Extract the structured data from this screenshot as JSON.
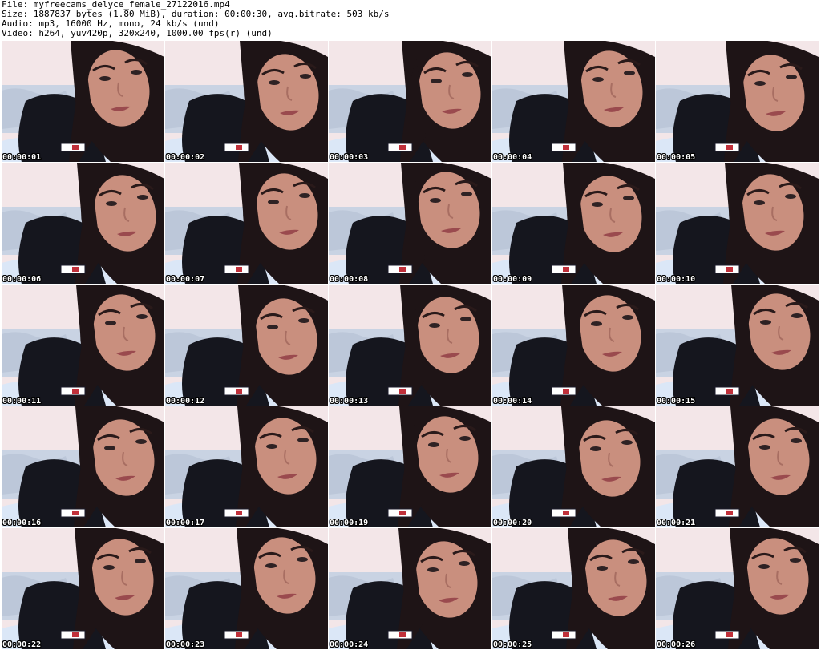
{
  "header": {
    "file_line": "File: myfreecams_delyce_female_27122016.mp4",
    "size_line": "Size: 1887837 bytes (1.80 MiB), duration: 00:00:30, avg.bitrate: 503 kb/s",
    "audio_line": "Audio: mp3, 16000 Hz, mono, 24 kb/s (und)",
    "video_line": "Video: h264, yuv420p, 320x240, 1000.00 fps(r) (und)"
  },
  "thumbnails": [
    {
      "time": "00:00:01"
    },
    {
      "time": "00:00:02"
    },
    {
      "time": "00:00:03"
    },
    {
      "time": "00:00:04"
    },
    {
      "time": "00:00:05"
    },
    {
      "time": "00:00:06"
    },
    {
      "time": "00:00:07"
    },
    {
      "time": "00:00:08"
    },
    {
      "time": "00:00:09"
    },
    {
      "time": "00:00:10"
    },
    {
      "time": "00:00:11"
    },
    {
      "time": "00:00:12"
    },
    {
      "time": "00:00:13"
    },
    {
      "time": "00:00:14"
    },
    {
      "time": "00:00:15"
    },
    {
      "time": "00:00:16"
    },
    {
      "time": "00:00:17"
    },
    {
      "time": "00:00:19"
    },
    {
      "time": "00:00:20"
    },
    {
      "time": "00:00:21"
    },
    {
      "time": "00:00:22"
    },
    {
      "time": "00:00:23"
    },
    {
      "time": "00:00:24"
    },
    {
      "time": "00:00:25"
    },
    {
      "time": "00:00:26"
    }
  ],
  "colors": {
    "wall": "#f3e6e8",
    "pillow": "#c9d3e3",
    "blanket": "#dbe7f7",
    "hair": "#1e1416",
    "hoodie": "#15161e",
    "skin": "#c98f7e",
    "lips": "#9a4a4e",
    "timestamp": "#ffffff"
  }
}
